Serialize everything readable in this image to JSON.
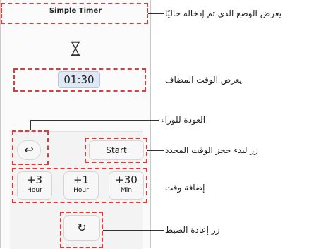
{
  "app": {
    "title": "Simple Timer"
  },
  "timer": {
    "icon": "hourglass-icon",
    "added_time": "01:30"
  },
  "controls": {
    "back_icon": "back-arrow-icon",
    "back_glyph": "↩",
    "start_label": "Start",
    "add_buttons": [
      {
        "value": "+3",
        "unit": "Hour"
      },
      {
        "value": "+1",
        "unit": "Hour"
      },
      {
        "value": "+30",
        "unit": "Min"
      }
    ],
    "reset_icon": "reset-icon",
    "reset_glyph": "↻"
  },
  "annotations": {
    "mode": "يعرض الوضع الذي تم إدخاله حاليًا",
    "added_time": "يعرض الوقت المضاف",
    "back": "العودة للوراء",
    "start": "زر لبدء حجز الوقت المحدد",
    "add_time": "إضافة وقت",
    "reset": "زر إعادة الضبط"
  },
  "colors": {
    "highlight": "#e03a3a",
    "time_box_bg": "#dfe9f6"
  }
}
